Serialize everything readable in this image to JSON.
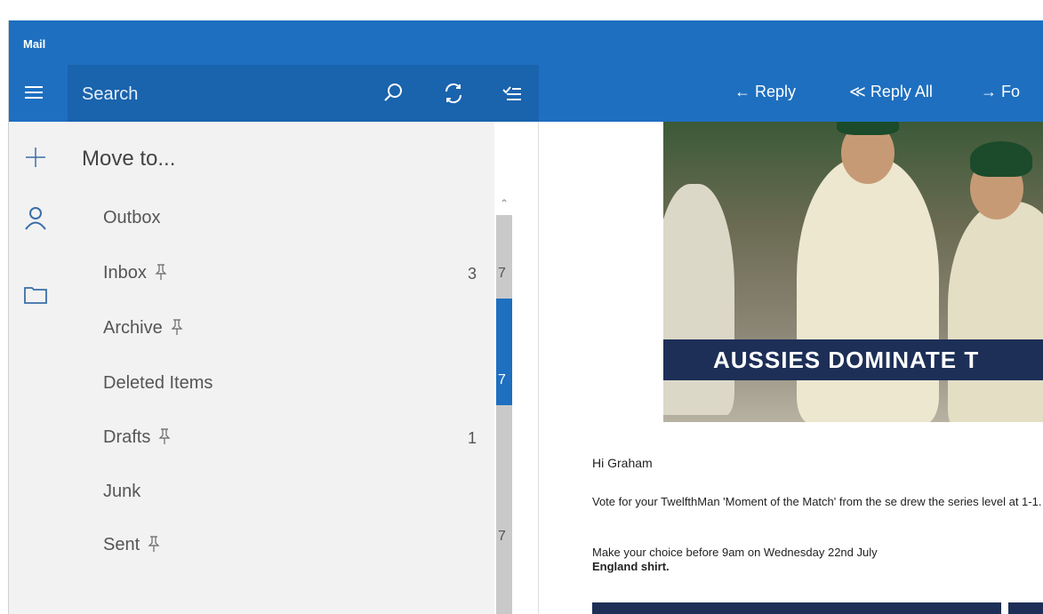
{
  "window": {
    "title": "Mail"
  },
  "command_bar": {
    "search_placeholder": "Search",
    "icons": {
      "menu": "hamburger-icon",
      "search": "search-icon",
      "sync": "sync-icon",
      "select": "select-mode-icon"
    },
    "actions": [
      {
        "label": "← Reply"
      },
      {
        "label": "≪ Reply All"
      },
      {
        "label": "→ Fo"
      }
    ]
  },
  "nav_rail": {
    "icons": [
      "plus-icon",
      "person-icon",
      "folder-icon"
    ]
  },
  "folder_pane": {
    "heading": "Move to...",
    "folders": [
      {
        "name": "Outbox",
        "pinned": false,
        "count": ""
      },
      {
        "name": "Inbox",
        "pinned": true,
        "count": "3"
      },
      {
        "name": "Archive",
        "pinned": true,
        "count": ""
      },
      {
        "name": "Deleted Items",
        "pinned": false,
        "count": ""
      },
      {
        "name": "Drafts",
        "pinned": true,
        "count": "1"
      },
      {
        "name": "Junk",
        "pinned": false,
        "count": ""
      },
      {
        "name": "Sent",
        "pinned": true,
        "count": ""
      }
    ]
  },
  "message_list": {
    "peek": [
      "7",
      "7",
      "7"
    ]
  },
  "reading_pane": {
    "banner": "AUSSIES DOMINATE T",
    "greeting": "Hi Graham",
    "paragraph1": "Vote for your TwelfthMan 'Moment of the Match' from the se drew the series level at 1-1.",
    "paragraph2_plain": "Make your choice before 9am on Wednesday 22nd July",
    "paragraph2_bold": "England shirt."
  },
  "colors": {
    "accent": "#1e6fc0",
    "pane_bg": "#f2f2f2",
    "banner": "#1d2f57"
  }
}
